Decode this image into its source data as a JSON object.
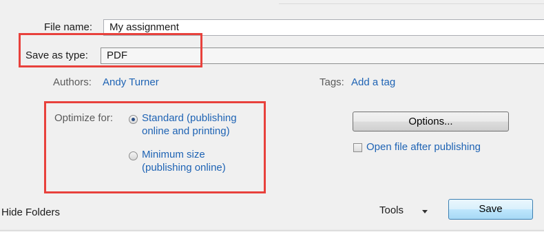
{
  "form": {
    "file_name_label": "File name:",
    "file_name_value": "My assignment",
    "save_as_type_label": "Save as type:",
    "save_as_type_value": "PDF",
    "authors_label": "Authors:",
    "authors_value": "Andy Turner",
    "tags_label": "Tags:",
    "tags_value": "Add a tag"
  },
  "optimize": {
    "label": "Optimize for:",
    "options": [
      {
        "line1": "Standard (publishing",
        "line2": "online and printing)",
        "selected": true
      },
      {
        "line1": "Minimum size",
        "line2": "(publishing online)",
        "selected": false
      }
    ]
  },
  "options_button": "Options...",
  "open_after_publishing": {
    "label": "Open file after publishing",
    "checked": false
  },
  "footer": {
    "hide_folders": "Hide Folders",
    "tools": "Tools",
    "save": "Save"
  },
  "colors": {
    "link": "#1e63b4",
    "highlight": "#e8413c",
    "dialog_background": "#f0f0f0"
  }
}
